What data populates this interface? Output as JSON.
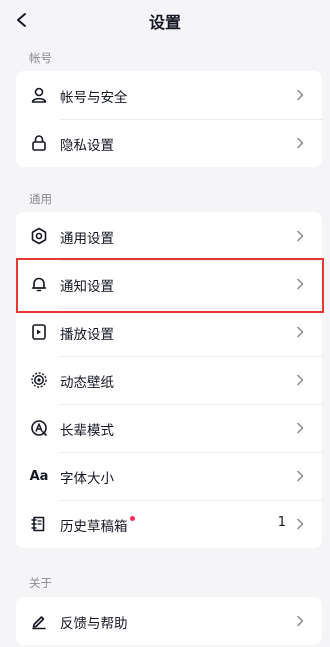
{
  "header": {
    "title": "设置",
    "back_icon": "chevron-left-icon"
  },
  "sections": {
    "account": {
      "label": "帐号",
      "items": [
        {
          "label": "帐号与安全",
          "icon": "person-icon"
        },
        {
          "label": "隐私设置",
          "icon": "lock-icon"
        }
      ]
    },
    "general": {
      "label": "通用",
      "items": [
        {
          "label": "通用设置",
          "icon": "gear-icon"
        },
        {
          "label": "通知设置",
          "icon": "bell-icon"
        },
        {
          "label": "播放设置",
          "icon": "play-settings-icon"
        },
        {
          "label": "动态壁纸",
          "icon": "live-wallpaper-icon"
        },
        {
          "label": "长辈模式",
          "icon": "elder-mode-icon"
        },
        {
          "label": "字体大小",
          "icon": "font-size-icon",
          "icon_text": "Aa"
        },
        {
          "label": "历史草稿箱",
          "icon": "drafts-icon",
          "value": "1",
          "badge_color": "#fe2c55"
        }
      ]
    },
    "about": {
      "label": "关于",
      "items": [
        {
          "label": "反馈与帮助",
          "icon": "pen-icon"
        }
      ]
    }
  },
  "colors": {
    "accent_dot": "#fe2c55",
    "highlight_border": "#e53935"
  }
}
